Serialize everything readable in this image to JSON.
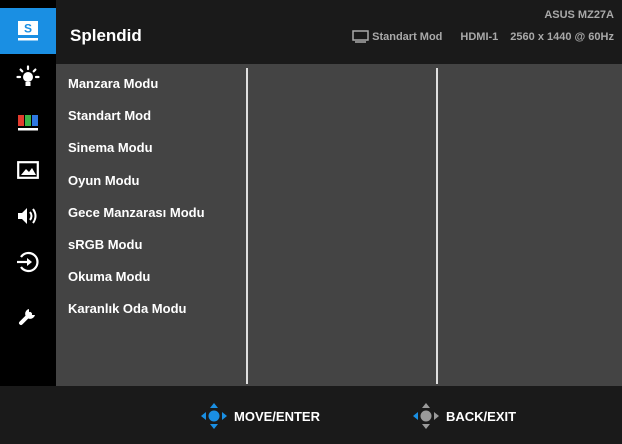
{
  "header": {
    "title": "Splendid",
    "model": "ASUS MZ27A",
    "current_mode": "Standart Mod",
    "input": "HDMI-1",
    "resolution": "2560 x 1440 @ 60Hz"
  },
  "sidebar": {
    "items": [
      {
        "icon": "splendid-s-icon",
        "active": true
      },
      {
        "icon": "blue-light-filter-icon"
      },
      {
        "icon": "color-bars-icon"
      },
      {
        "icon": "image-icon"
      },
      {
        "icon": "speaker-icon"
      },
      {
        "icon": "input-select-icon"
      },
      {
        "icon": "wrench-icon"
      }
    ]
  },
  "menu": {
    "items": [
      "Manzara Modu",
      "Standart Mod",
      "Sinema Modu",
      "Oyun Modu",
      "Gece Manzarası Modu",
      "sRGB Modu",
      "Okuma Modu",
      "Karanlık Oda Modu"
    ]
  },
  "footer": {
    "move_enter": "MOVE/ENTER",
    "back_exit": "BACK/EXIT"
  },
  "colors": {
    "accent": "#1a8fe3",
    "panel": "#444444",
    "background": "#1a1a1a"
  }
}
